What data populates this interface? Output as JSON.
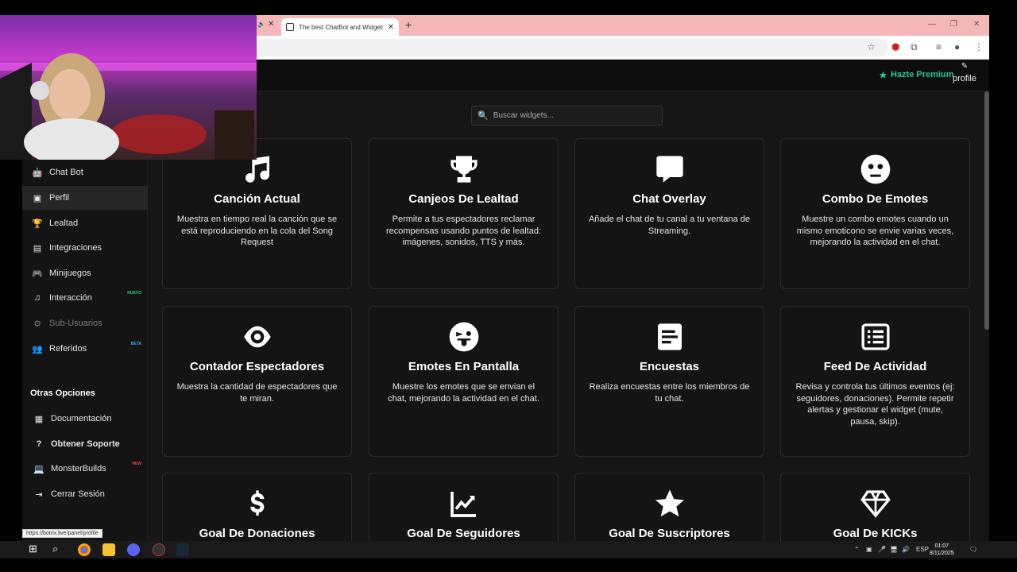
{
  "browser": {
    "tab_title": "The best ChatBot and Widgets",
    "status_url": "https://botrix.live/panel/profile"
  },
  "header": {
    "premium_label": "Hazte Premium",
    "profile_label": "profile"
  },
  "sidebar": {
    "items": [
      {
        "label": "Chat Bot",
        "icon": "robot-icon"
      },
      {
        "label": "Perfil",
        "icon": "id-card-icon"
      },
      {
        "label": "Lealtad",
        "icon": "trophy-icon"
      },
      {
        "label": "Integraciones",
        "icon": "puzzle-icon"
      },
      {
        "label": "Minijuegos",
        "icon": "gamepad-icon"
      },
      {
        "label": "Interacción",
        "icon": "music-icon",
        "badge": "NUEVO"
      },
      {
        "label": "Sub-Usuarios",
        "icon": "users-icon"
      },
      {
        "label": "Referidos",
        "icon": "group-icon",
        "badge": "BETA"
      }
    ],
    "section_title": "Otras Opciones",
    "other": [
      {
        "label": "Documentación",
        "icon": "book-icon"
      },
      {
        "label": "Obtener Soporte",
        "icon": "question-icon"
      },
      {
        "label": "MonsterBuilds",
        "icon": "laptop-icon",
        "badge": "NEW"
      },
      {
        "label": "Cerrar Sesión",
        "icon": "logout-icon"
      }
    ]
  },
  "search": {
    "placeholder": "Buscar widgets..."
  },
  "widgets": [
    {
      "title": "Canción Actual",
      "desc": "Muestra en tiempo real la canción que se está reproduciendo en la cola del Song Request",
      "icon": "music-note-icon"
    },
    {
      "title": "Canjeos De Lealtad",
      "desc": "Permite a tus espectadores reclamar recompensas usando puntos de lealtad: imágenes, sonidos, TTS y más.",
      "icon": "trophy-icon"
    },
    {
      "title": "Chat Overlay",
      "desc": "Añade el chat de tu canal a tu ventana de Streaming.",
      "icon": "chat-bubble-icon"
    },
    {
      "title": "Combo De Emotes",
      "desc": "Muestre un combo emotes cuando un mismo emoticono se envie varias veces, mejorando la actividad en el chat.",
      "icon": "face-icon"
    },
    {
      "title": "Contador Espectadores",
      "desc": "Muestra la cantidad de espectadores que te miran.",
      "icon": "eye-icon"
    },
    {
      "title": "Emotes En Pantalla",
      "desc": "Muestre los emotes que se envian el chat, mejorando la actividad en el chat.",
      "icon": "tongue-face-icon"
    },
    {
      "title": "Encuestas",
      "desc": "Realiza encuestas entre los miembros de tu chat.",
      "icon": "poll-icon"
    },
    {
      "title": "Feed De Actividad",
      "desc": "Revisa y controla tus últimos eventos (ej: seguidores, donaciones). Permite repetir alertas y gestionar el widget (mute, pausa, skip).",
      "icon": "list-icon"
    },
    {
      "title": "Goal De Donaciones",
      "desc": "",
      "icon": "dollar-icon"
    },
    {
      "title": "Goal De Seguidores",
      "desc": "",
      "icon": "chart-up-icon"
    },
    {
      "title": "Goal De Suscriptores",
      "desc": "",
      "icon": "star-icon"
    },
    {
      "title": "Goal De KICKs",
      "desc": "",
      "icon": "diamond-icon"
    }
  ],
  "taskbar": {
    "language": "ESP",
    "time": "01:07",
    "date": "8/11/2025"
  },
  "colors": {
    "accent": "#20c997",
    "background": "#161616",
    "card": "#141414"
  }
}
